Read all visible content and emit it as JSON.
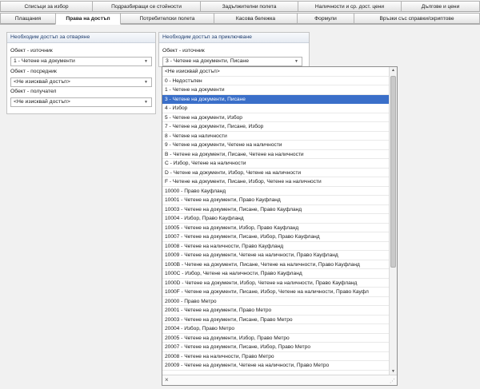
{
  "tabs_row1": [
    "Списъци за избор",
    "Подразбиращи се стойности",
    "Задължителни полета",
    "Наличности и ср. дост. цени",
    "Дългове и цени"
  ],
  "tabs_row2": [
    "Плащания",
    "Права на достъп",
    "Потребителски полета",
    "Касова бележка",
    "Формули",
    "Връзки със справки/скриптове"
  ],
  "open_access": {
    "header": "Необходим достъп за отваряне",
    "source_label": "Обект - източник",
    "source_value": "1 - Четене на документи",
    "intermediary_label": "Обект - посредник",
    "intermediary_value": "<Не изисквай достъп>",
    "receiver_label": "Обект - получател",
    "receiver_value": "<Не изисквай достъп>"
  },
  "accept_access": {
    "header": "Необходим достъп за приключване",
    "source_label": "Обект - източник",
    "source_value": "3 - Четене на документи, Писане"
  },
  "dropdown": {
    "selected_index": 3,
    "items": [
      "<Не изисквай достъп>",
      "0 - Недостъпен",
      "1 - Четене на документи",
      "3 - Четене на документи, Писане",
      "4 - Избор",
      "5 - Четене на документи, Избор",
      "7 - Четене на документи, Писане, Избор",
      "8 - Четене на наличности",
      "9 - Четене на документи, Четене на наличности",
      "B - Четене на документи, Писане, Четене на наличности",
      "C - Избор, Четене на наличности",
      "D - Четене на документи, Избор, Четене на наличности",
      "F - Четене на документи, Писане, Избор, Четене на наличности",
      "10000 - Право Кауфланд",
      "10001 - Четене на документи, Право Кауфланд",
      "10003 - Четене на документи, Писане, Право Кауфланд",
      "10004 - Избор, Право Кауфланд",
      "10005 - Четене на документи, Избор, Право Кауфланд",
      "10007 - Четене на документи, Писане, Избор, Право Кауфланд",
      "10008 - Четене на наличности, Право Кауфланд",
      "10009 - Четене на документи, Четене на наличности, Право Кауфланд",
      "1000B - Четене на документи, Писане, Четене на наличности, Право Кауфланд",
      "1000C - Избор, Четене на наличности, Право Кауфланд",
      "1000D - Четене на документи, Избор, Четене на наличности, Право Кауфланд",
      "1000F - Четене на документи, Писане, Избор, Четене на наличности, Право Кауфл",
      "20000 - Право Метро",
      "20001 - Четене на документи, Право Метро",
      "20003 - Четене на документи, Писане, Право Метро",
      "20004 - Избор, Право Метро",
      "20005 - Четене на документи, Избор, Право Метро",
      "20007 - Четене на документи, Писане, Избор, Право Метро",
      "20008 - Четене на наличности, Право Метро",
      "20009 - Четене на документи, Четене на наличности, Право Метро"
    ],
    "close_icon": "×"
  },
  "colors": {
    "selection": "#3a6fc9",
    "group_header_text": "#1e3d6e"
  }
}
